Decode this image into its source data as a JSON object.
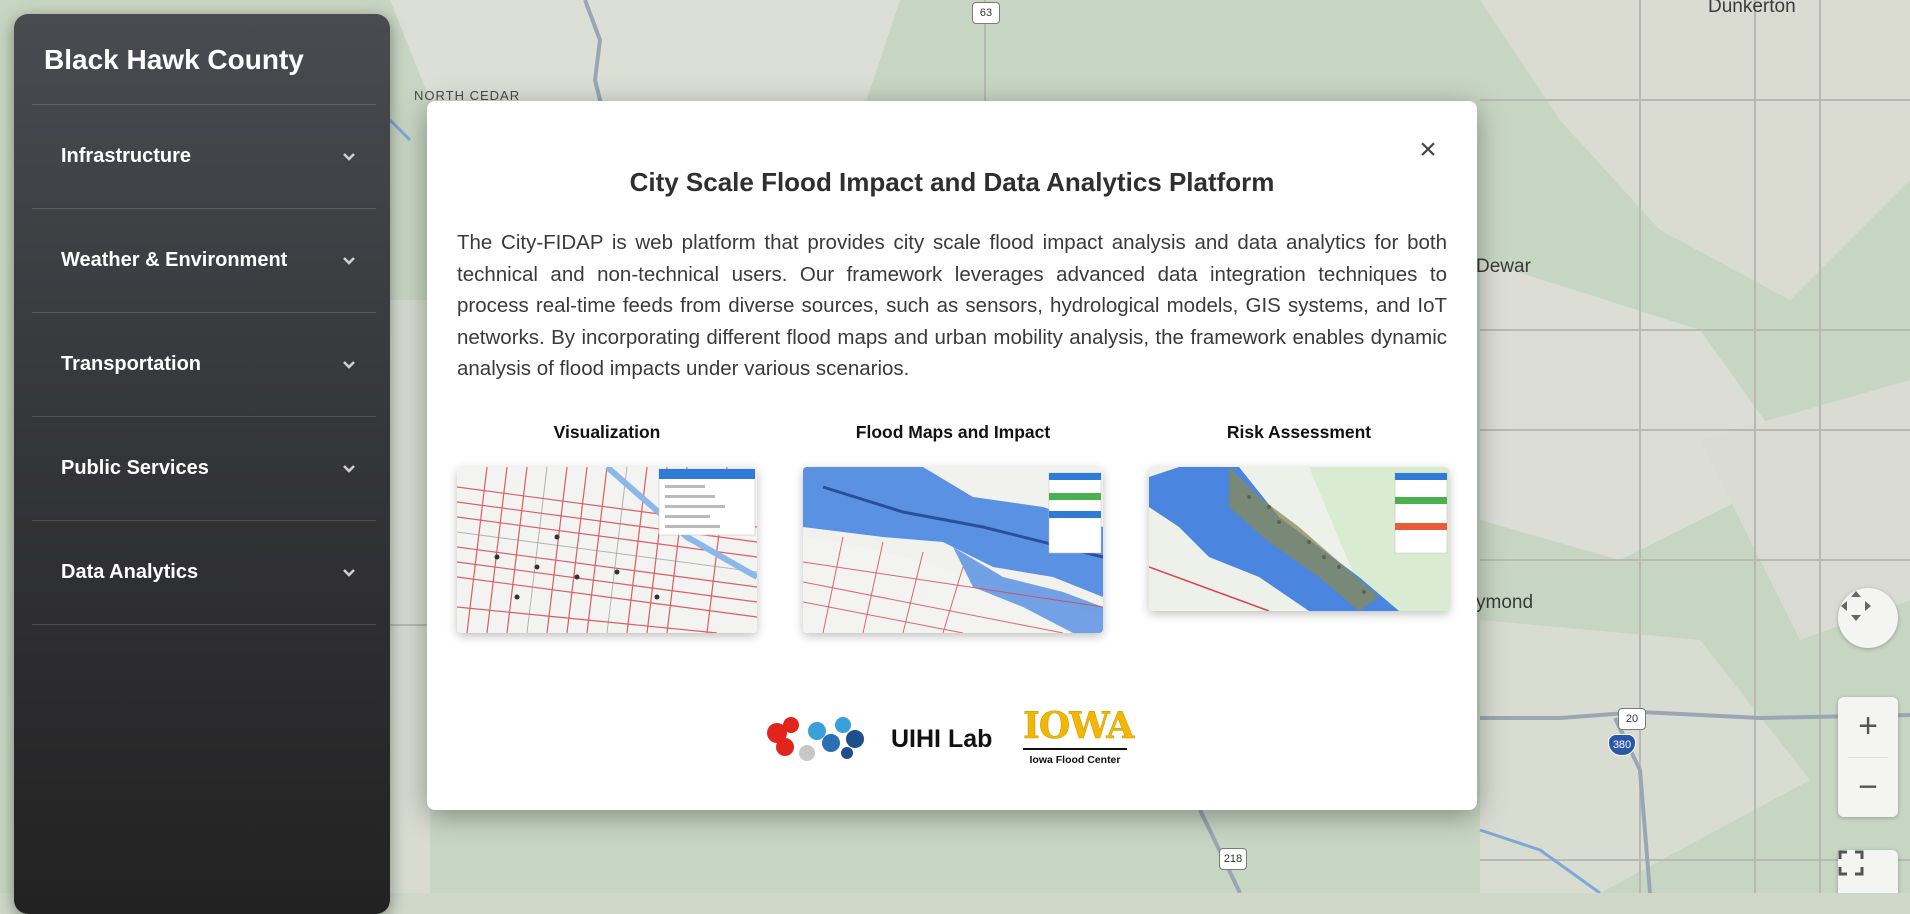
{
  "map": {
    "labels": {
      "north_cedar": "NORTH CEDAR",
      "dunkerton": "Dunkerton",
      "dewar": "Dewar",
      "raymond": "ymond"
    },
    "shields": {
      "us63": "63",
      "us20": "20",
      "i380": "380",
      "us218": "218"
    },
    "controls": {
      "zoom_in": "+",
      "zoom_out": "−"
    }
  },
  "sidebar": {
    "title": "Black Hawk County",
    "items": [
      {
        "label": "Infrastructure"
      },
      {
        "label": "Weather & Environment"
      },
      {
        "label": "Transportation"
      },
      {
        "label": "Public Services"
      },
      {
        "label": "Data Analytics"
      }
    ]
  },
  "modal": {
    "close_label": "×",
    "title": "City Scale Flood Impact and Data Analytics Platform",
    "description": "The City-FIDAP is web platform that provides city scale flood impact analysis and data analytics for both technical and non-technical users. Our framework leverages advanced data integration techniques to process real-time feeds from diverse sources, such as sensors, hydrological models, GIS systems, and IoT networks. By incorporating different flood maps and urban mobility analysis, the framework enables dynamic analysis of flood impacts under various scenarios.",
    "features": [
      {
        "title": "Visualization"
      },
      {
        "title": "Flood Maps and Impact"
      },
      {
        "title": "Risk Assessment"
      }
    ],
    "logos": {
      "uihi": "UIHI Lab",
      "iowa_word": "IOWA",
      "iowa_sub": "Iowa Flood Center"
    }
  },
  "colors": {
    "map_bg": "#c7d6c2",
    "sidebar_top": "#4a4b50",
    "sidebar_bottom": "#222222",
    "flood_blue": "#4a86e0",
    "road_red": "#d9434e",
    "iowa_gold": "#f2b705"
  }
}
